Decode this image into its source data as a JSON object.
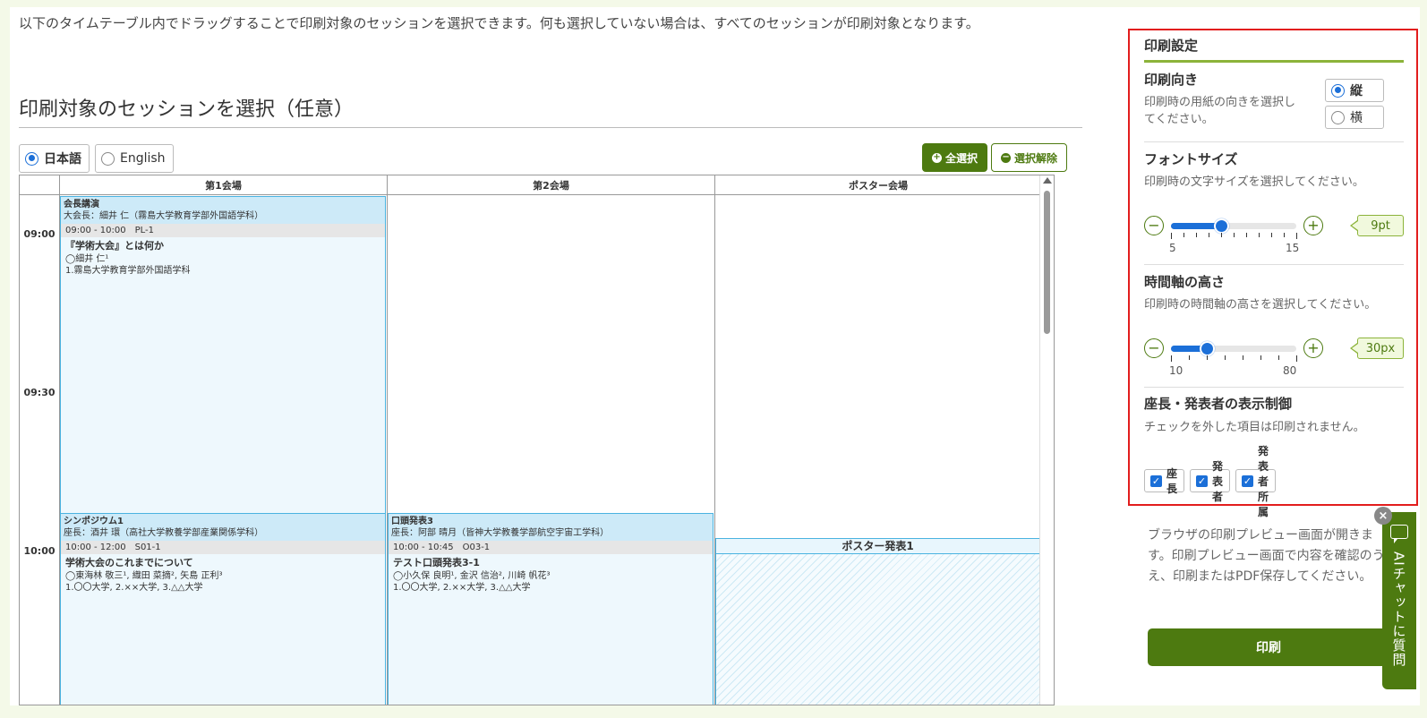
{
  "intro_text": "以下のタイムテーブル内でドラッグすることで印刷対象のセッションを選択できます。何も選択していない場合は、すべてのセッションが印刷対象となります。",
  "section_title": "印刷対象のセッションを選択（任意）",
  "language": {
    "options": [
      "日本語",
      "English"
    ],
    "selected": "日本語"
  },
  "selection_buttons": {
    "select_all": "全選択",
    "deselect": "選択解除"
  },
  "timetable": {
    "columns": [
      "第1会場",
      "第2会場",
      "ポスター会場"
    ],
    "times": [
      "09:00",
      "09:30",
      "10:00"
    ],
    "sessions": [
      {
        "type": "会長講演",
        "chair": "大会長：細井 仁（霧島大学教育学部外国語学科）",
        "time_code": "09:00 - 10:00　PL-1",
        "title": "『学術大会』とは何か",
        "authors": "◯細井 仁¹",
        "affiliations": "1.霧島大学教育学部外国語学科"
      },
      {
        "type": "シンポジウム1",
        "chair": "座長：酒井 環（高社大学教養学部産業関係学科）",
        "time_code": "10:00 - 12:00　S01-1",
        "title": "学術大会のこれまでについて",
        "authors": "◯東海林 敬三¹, 織田 菜摘², 矢島 正利³",
        "affiliations": "1.〇〇大学, 2.××大学, 3.△△大学"
      },
      {
        "type": "口頭発表3",
        "chair": "座長：阿部 晴月（皆神大学教養学部航空宇宙工学科）",
        "time_code": "10:00 - 10:45　O03-1",
        "title": "テスト口頭発表3-1",
        "authors": "◯小久保 良明¹, 金沢 信治², 川崎 帆花³",
        "affiliations": "1.〇〇大学, 2.××大学, 3.△△大学"
      }
    ],
    "poster_session": "ポスター発表1"
  },
  "settings": {
    "title": "印刷設定",
    "orientation": {
      "heading": "印刷向き",
      "desc": "印刷時の用紙の向きを選択してください。",
      "options": [
        "縦",
        "横"
      ],
      "selected": "縦"
    },
    "font_size": {
      "heading": "フォントサイズ",
      "desc": "印刷時の文字サイズを選択してください。",
      "min": "5",
      "max": "15",
      "value": 9,
      "value_label": "9pt"
    },
    "time_axis": {
      "heading": "時間軸の高さ",
      "desc": "印刷時の時間軸の高さを選択してください。",
      "min": "10",
      "max": "80",
      "value": 30,
      "value_label": "30px"
    },
    "display_control": {
      "heading": "座長・発表者の表示制御",
      "desc": "チェックを外した項目は印刷されません。",
      "options": [
        "座長",
        "発表者",
        "発表者所属"
      ]
    }
  },
  "print_note": "ブラウザの印刷プレビュー画面が開きます。印刷プレビュー画面で内容を確認のうえ、印刷またはPDF保存してください。",
  "print_button": "印刷",
  "ai_chat": {
    "label": "AIチャットに質問"
  },
  "colors": {
    "accent_green": "#4d7a10",
    "highlight_red": "#e21d1d",
    "session_blue": "#4ab3e0",
    "radio_blue": "#1b6fd8"
  }
}
